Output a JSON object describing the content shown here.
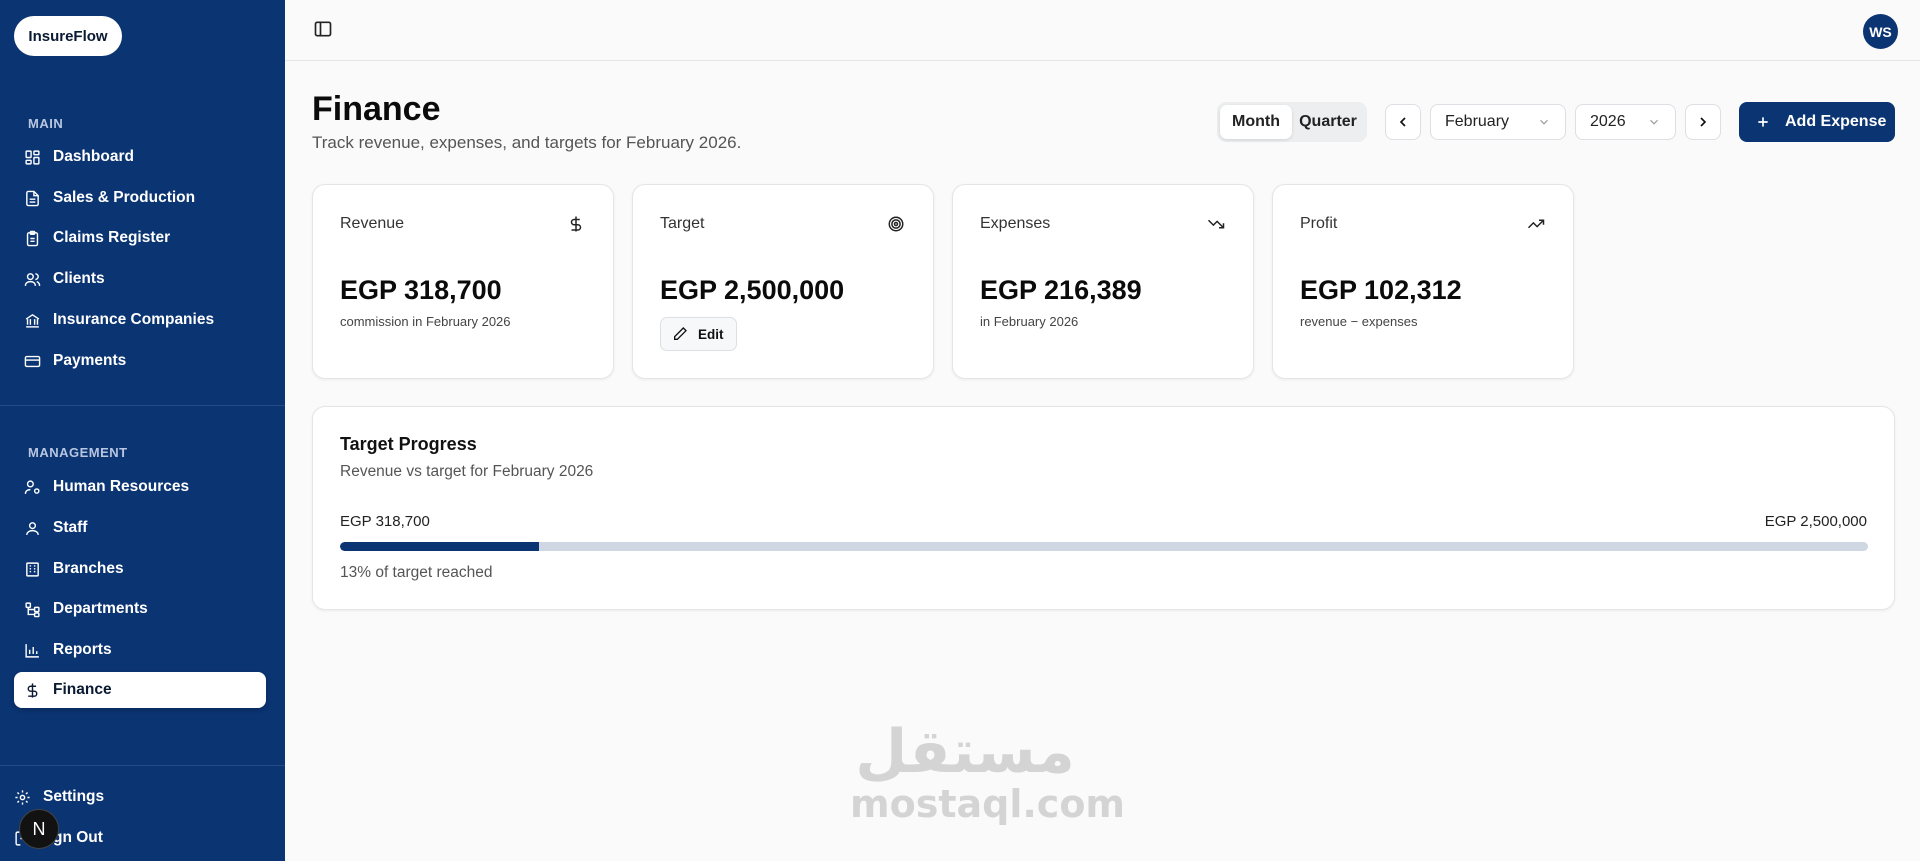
{
  "app": {
    "logo": "InsureFlow"
  },
  "sidebar": {
    "main_label": "MAIN",
    "main_items": [
      {
        "label": "Dashboard",
        "icon": "grid-icon"
      },
      {
        "label": "Sales & Production",
        "icon": "file-icon"
      },
      {
        "label": "Claims Register",
        "icon": "clipboard-icon"
      },
      {
        "label": "Clients",
        "icon": "users-icon"
      },
      {
        "label": "Insurance Companies",
        "icon": "bank-icon"
      },
      {
        "label": "Payments",
        "icon": "credit-card-icon"
      }
    ],
    "management_label": "MANAGEMENT",
    "management_items": [
      {
        "label": "Human Resources",
        "icon": "user-cog-icon"
      },
      {
        "label": "Staff",
        "icon": "user-icon"
      },
      {
        "label": "Branches",
        "icon": "building-icon"
      },
      {
        "label": "Departments",
        "icon": "network-icon"
      },
      {
        "label": "Reports",
        "icon": "bar-chart-icon"
      },
      {
        "label": "Finance",
        "icon": "dollar-icon",
        "active": true
      }
    ],
    "settings": "Settings",
    "signout": "gn Out",
    "overlay_badge": "N"
  },
  "topbar": {
    "avatar": "WS"
  },
  "header": {
    "title": "Finance",
    "subtitle": "Track revenue, expenses, and targets for February 2026.",
    "period_options": [
      "Month",
      "Quarter"
    ],
    "period_selected": "Month",
    "month": "February",
    "year": "2026",
    "add_button": "Add Expense"
  },
  "cards": {
    "revenue": {
      "title": "Revenue",
      "value": "EGP 318,700",
      "sub": "commission in February 2026",
      "icon": "dollar-icon"
    },
    "target": {
      "title": "Target",
      "value": "EGP 2,500,000",
      "edit": "Edit",
      "icon": "target-icon"
    },
    "expenses": {
      "title": "Expenses",
      "value": "EGP 216,389",
      "sub": "in February 2026",
      "icon": "trending-down-icon"
    },
    "profit": {
      "title": "Profit",
      "value": "EGP 102,312",
      "sub": "revenue − expenses",
      "icon": "trending-up-icon"
    }
  },
  "progress": {
    "title": "Target Progress",
    "subtitle": "Revenue vs target for February 2026",
    "left_label": "EGP 318,700",
    "right_label": "EGP 2,500,000",
    "percent_text": "13% of target reached",
    "fraction": 0.13
  },
  "watermark": {
    "arabic": "مستقل",
    "latin": "mostaql.com"
  },
  "colors": {
    "brand": "#0b3472",
    "background": "#fafafa",
    "track": "#cfd7e3"
  }
}
